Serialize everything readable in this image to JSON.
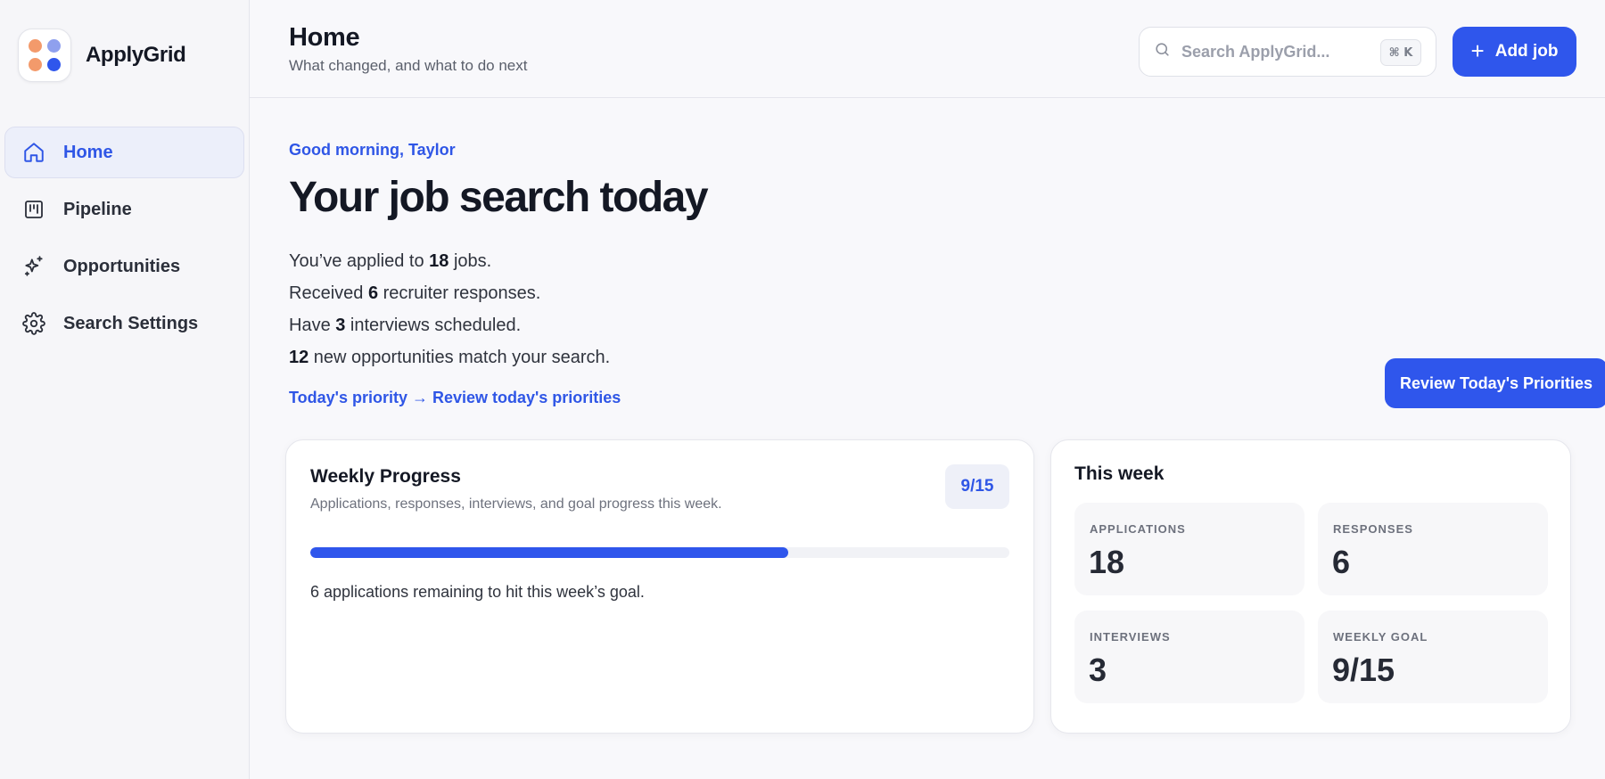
{
  "brand": {
    "name": "ApplyGrid",
    "logo_colors": [
      "#f39a6b",
      "#8fa0ee",
      "#f39a6b",
      "#2f56ec"
    ]
  },
  "sidebar": {
    "items": [
      {
        "label": "Home",
        "icon": "home-icon",
        "active": true
      },
      {
        "label": "Pipeline",
        "icon": "kanban-icon",
        "active": false
      },
      {
        "label": "Opportunities",
        "icon": "sparkles-icon",
        "active": false
      },
      {
        "label": "Search Settings",
        "icon": "gear-icon",
        "active": false
      }
    ]
  },
  "header": {
    "title": "Home",
    "subtitle": "What changed, and what to do next",
    "search_placeholder": "Search ApplyGrid...",
    "search_shortcut": "⌘ K",
    "add_button": "Add job"
  },
  "hero": {
    "greeting": "Good morning, Taylor",
    "title": "Your job search today",
    "lines": [
      {
        "pre": "You’ve applied to ",
        "num": "18",
        "post": " jobs."
      },
      {
        "pre": "Received ",
        "num": "6",
        "post": " recruiter responses."
      },
      {
        "pre": "Have ",
        "num": "3",
        "post": " interviews scheduled."
      },
      {
        "pre": "",
        "num": "12",
        "post": " new opportunities match your search."
      }
    ],
    "priority_link": "Today's priority → Review today's priorities",
    "review_button": "Review Today's Priorities"
  },
  "progress_card": {
    "title": "Weekly Progress",
    "subtitle": "Applications, responses, interviews, and goal progress this week.",
    "badge": "9/15",
    "progress_fraction": 0.6833,
    "note_num": "6",
    "note_text": " applications remaining to hit this week’s goal."
  },
  "week_card": {
    "title": "This week",
    "stats": [
      {
        "label": "Applications",
        "value": "18"
      },
      {
        "label": "Responses",
        "value": "6"
      },
      {
        "label": "Interviews",
        "value": "3"
      },
      {
        "label": "Weekly goal",
        "value": "9/15"
      }
    ]
  },
  "colors": {
    "accent": "#2f56ec",
    "accent_text": "#2f56e6"
  }
}
